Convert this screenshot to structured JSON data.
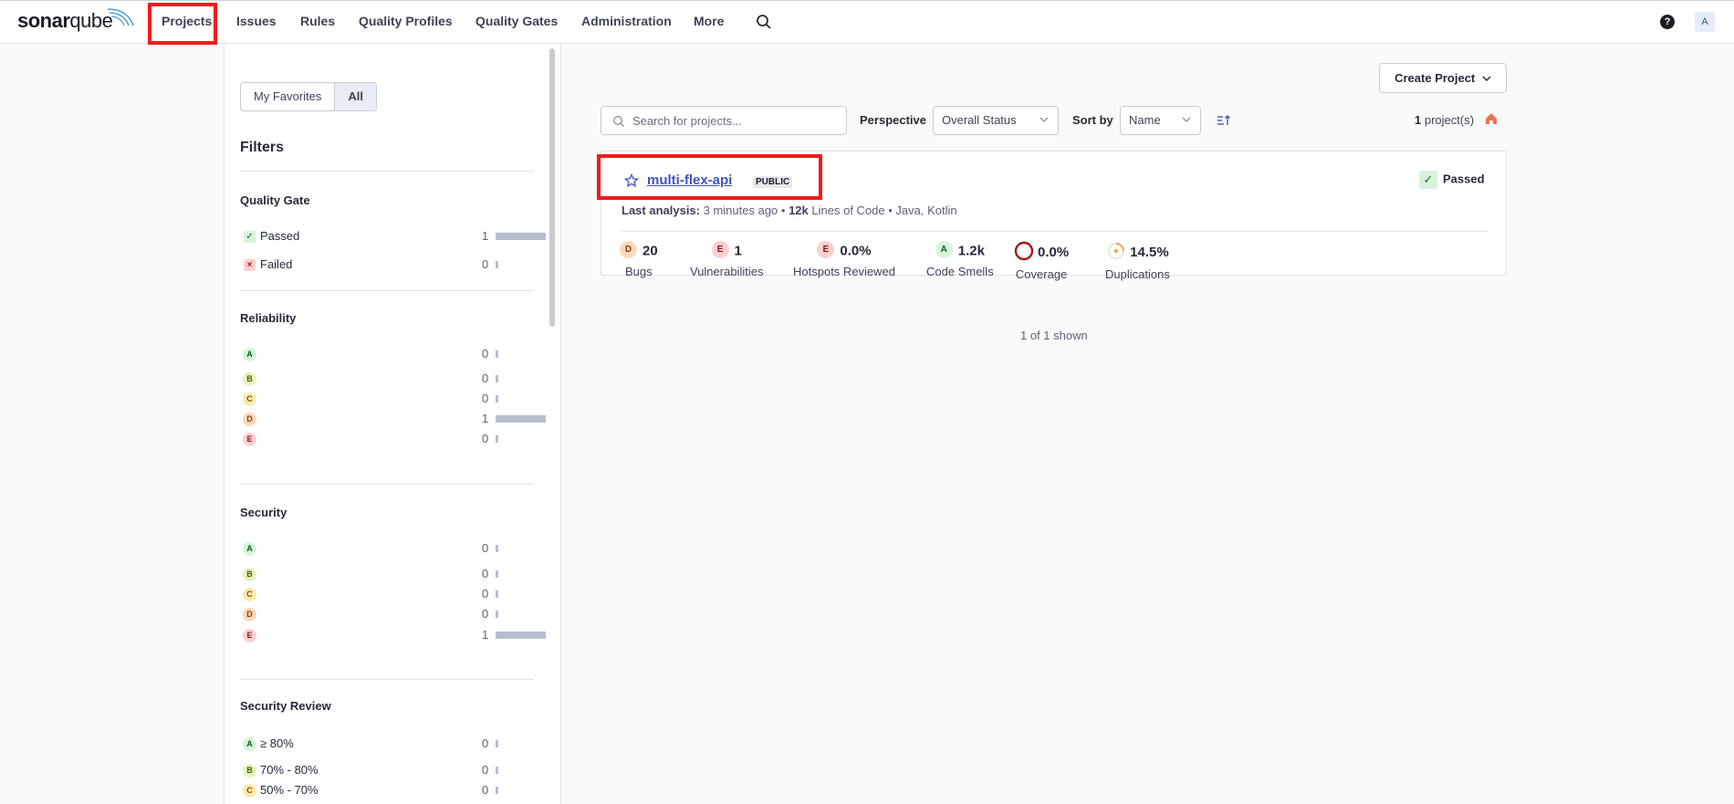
{
  "app": {
    "logo_text_1": "sonar",
    "logo_text_2": "qube"
  },
  "nav": {
    "items": [
      "Projects",
      "Issues",
      "Rules",
      "Quality Profiles",
      "Quality Gates",
      "Administration",
      "More"
    ],
    "avatar_initial": "A",
    "help_label": "?"
  },
  "sidebar": {
    "toggle": [
      "My Favorites",
      "All"
    ],
    "filters_title": "Filters",
    "quality_gate": {
      "title": "Quality Gate",
      "rows": [
        {
          "label": "Passed",
          "count": "1",
          "fraction": 1.0
        },
        {
          "label": "Failed",
          "count": "0",
          "fraction": 0.0
        }
      ]
    },
    "reliability": {
      "title": "Reliability",
      "rows": [
        {
          "grade": "A",
          "count": "0",
          "fraction": 0.0
        },
        {
          "grade": "B",
          "count": "0",
          "fraction": 0.0
        },
        {
          "grade": "C",
          "count": "0",
          "fraction": 0.0
        },
        {
          "grade": "D",
          "count": "1",
          "fraction": 1.0
        },
        {
          "grade": "E",
          "count": "0",
          "fraction": 0.0
        }
      ]
    },
    "security": {
      "title": "Security",
      "rows": [
        {
          "grade": "A",
          "count": "0",
          "fraction": 0.0
        },
        {
          "grade": "B",
          "count": "0",
          "fraction": 0.0
        },
        {
          "grade": "C",
          "count": "0",
          "fraction": 0.0
        },
        {
          "grade": "D",
          "count": "0",
          "fraction": 0.0
        },
        {
          "grade": "E",
          "count": "1",
          "fraction": 1.0
        }
      ]
    },
    "security_review": {
      "title": "Security Review",
      "rows": [
        {
          "grade": "A",
          "label": "≥ 80%",
          "count": "0",
          "fraction": 0.0
        },
        {
          "grade": "B",
          "label": "70% - 80%",
          "count": "0",
          "fraction": 0.0
        },
        {
          "grade": "C",
          "label": "50% - 70%",
          "count": "0",
          "fraction": 0.0
        }
      ]
    }
  },
  "main": {
    "create_project": "Create Project",
    "search_placeholder": "Search for projects...",
    "perspective_label": "Perspective",
    "perspective_value": "Overall Status",
    "sort_label": "Sort by",
    "sort_value": "Name",
    "count_number": "1",
    "count_suffix": "project(s)",
    "shown": "1 of 1 shown"
  },
  "project": {
    "name": "multi-flex-api",
    "visibility": "PUBLIC",
    "status": "Passed",
    "last_analysis_label": "Last analysis:",
    "last_analysis_value": "3 minutes ago",
    "loc_value": "12k",
    "loc_label": "Lines of Code",
    "languages": "Java, Kotlin",
    "metrics": [
      {
        "grade": "D",
        "value": "20",
        "label": "Bugs"
      },
      {
        "grade": "E",
        "value": "1",
        "label": "Vulnerabilities"
      },
      {
        "grade": "E",
        "value": "0.0%",
        "label": "Hotspots Reviewed"
      },
      {
        "grade": "A",
        "value": "1.2k",
        "label": "Code Smells"
      },
      {
        "icon": "coverage-ring-icon",
        "value": "0.0%",
        "label": "Coverage"
      },
      {
        "icon": "duplications-ring-icon",
        "value": "14.5%",
        "label": "Duplications"
      }
    ]
  },
  "colors": {
    "highlight": "#ef1b1b",
    "link": "#3f55c4",
    "bar": "#b7bfcf"
  }
}
